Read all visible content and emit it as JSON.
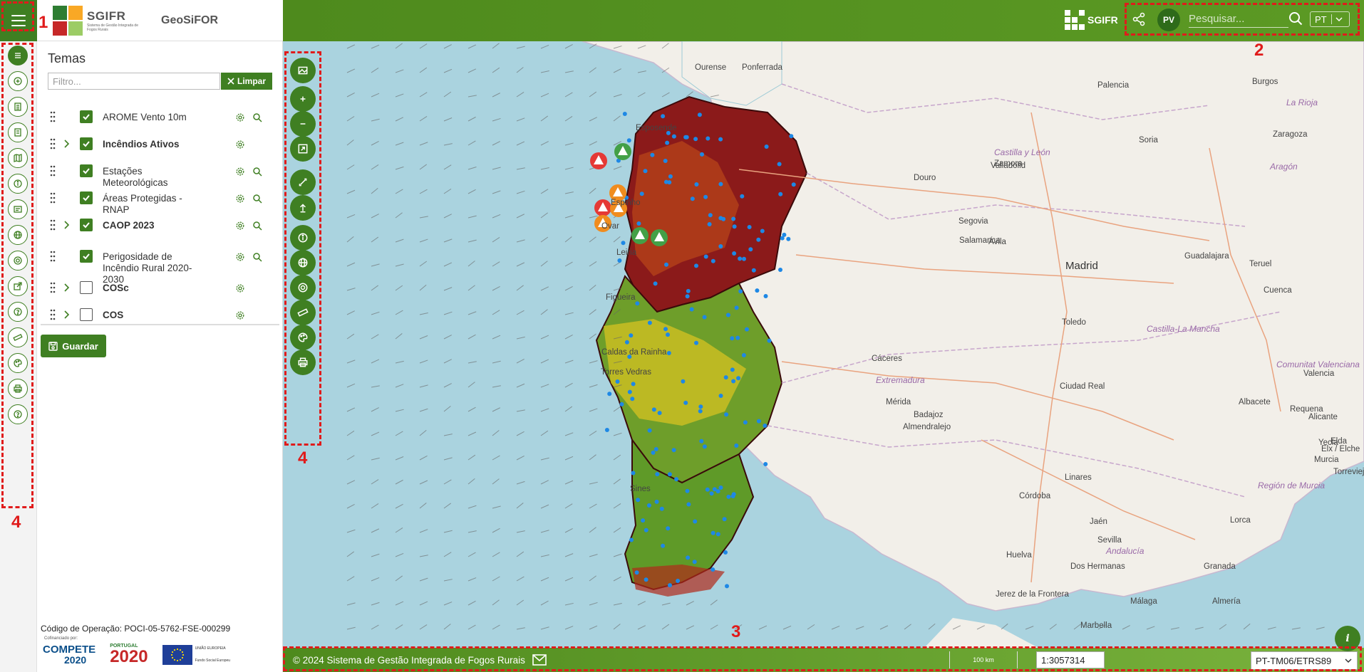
{
  "header": {
    "brand": "SGIFR",
    "brand_tagline": "Sistema de Gestão Integrada de Fogos Rurais",
    "app_title": "GeoSiFOR",
    "right_brand": "SGIFR",
    "avatar_initials": "PV",
    "search_placeholder": "Pesquisar...",
    "language": "PT"
  },
  "sidebar": {
    "icons": [
      "layers-icon",
      "add-layer-icon",
      "legend-icon",
      "document-icon",
      "map-icon",
      "info-icon",
      "image-icon",
      "globe-icon",
      "target-icon",
      "export-icon",
      "help-icon",
      "measure-icon",
      "palette-icon",
      "print-icon",
      "question-icon"
    ]
  },
  "layers_panel": {
    "title": "Temas",
    "filter_placeholder": "Filtro...",
    "clear_label": "Limpar",
    "save_label": "Guardar",
    "layers": [
      {
        "label": "AROME Vento 10m",
        "checked": true,
        "bold": false,
        "expandable": false,
        "has_zoom": true
      },
      {
        "label": "Incêndios Ativos",
        "checked": true,
        "bold": true,
        "expandable": true,
        "has_zoom": false
      },
      {
        "label": "Estações Meteorológicas",
        "checked": true,
        "bold": false,
        "expandable": false,
        "has_zoom": true
      },
      {
        "label": "Áreas Protegidas - RNAP",
        "checked": true,
        "bold": false,
        "expandable": false,
        "has_zoom": true
      },
      {
        "label": "CAOP 2023",
        "checked": true,
        "bold": true,
        "expandable": true,
        "has_zoom": true
      },
      {
        "label": "Perigosidade de Incêndio Rural 2020-2030",
        "checked": true,
        "bold": false,
        "expandable": false,
        "has_zoom": true
      },
      {
        "label": "COSc",
        "checked": false,
        "bold": true,
        "expandable": true,
        "has_zoom": false
      },
      {
        "label": "COS",
        "checked": false,
        "bold": true,
        "expandable": true,
        "has_zoom": false
      }
    ],
    "operation_code": "Código de Operação: POCI-05-5762-FSE-000299",
    "cofinanced_by": "Cofinanciado por:",
    "funders": {
      "compete": "COMPETE",
      "compete_year": "2020",
      "portugal_small": "PORTUGAL",
      "portugal_year": "2020",
      "eu_name": "UNIÃO EUROPEIA",
      "eu_fund": "Fundo Social Europeu"
    }
  },
  "map": {
    "place_labels": [
      {
        "name": "Ourense"
      },
      {
        "name": "Ponferrada"
      },
      {
        "name": "Palencia"
      },
      {
        "name": "Burgos"
      },
      {
        "name": "La Rioja"
      },
      {
        "name": "Castilla y León"
      },
      {
        "name": "Valladolid"
      },
      {
        "name": "Soria"
      },
      {
        "name": "Zaragoza"
      },
      {
        "name": "Aragón"
      },
      {
        "name": "Zamora"
      },
      {
        "name": "Douro"
      },
      {
        "name": "Esposende"
      },
      {
        "name": "Segovia"
      },
      {
        "name": "Espinho"
      },
      {
        "name": "Salamanca"
      },
      {
        "name": "Ávila"
      },
      {
        "name": "Madrid"
      },
      {
        "name": "Guadalajara"
      },
      {
        "name": "Teruel"
      },
      {
        "name": "Cuenca"
      },
      {
        "name": "Toledo"
      },
      {
        "name": "Castilla-La Mancha"
      },
      {
        "name": "Cáceres"
      },
      {
        "name": "Extremadura"
      },
      {
        "name": "Ciudad Real"
      },
      {
        "name": "Comunitat Valenciana"
      },
      {
        "name": "Badajoz"
      },
      {
        "name": "Mérida"
      },
      {
        "name": "Valencia"
      },
      {
        "name": "Albacete"
      },
      {
        "name": "Alicante"
      },
      {
        "name": "Elx / Elche"
      },
      {
        "name": "Murcia"
      },
      {
        "name": "Torrevieja"
      },
      {
        "name": "Región de Murcia"
      },
      {
        "name": "Linares"
      },
      {
        "name": "Jaén"
      },
      {
        "name": "Córdoba"
      },
      {
        "name": "Lorca"
      },
      {
        "name": "Sevilla"
      },
      {
        "name": "Andalucía"
      },
      {
        "name": "Granada"
      },
      {
        "name": "Huelva"
      },
      {
        "name": "Dos Hermanas"
      },
      {
        "name": "Almería"
      },
      {
        "name": "Jerez de la Frontera"
      },
      {
        "name": "Málaga"
      },
      {
        "name": "Marbella"
      },
      {
        "name": "Ovar"
      },
      {
        "name": "Figueira"
      },
      {
        "name": "Caldas da Rainha"
      },
      {
        "name": "Torres Vedras"
      },
      {
        "name": "Yecla"
      },
      {
        "name": "Requena"
      },
      {
        "name": "Elda"
      },
      {
        "name": "Sines"
      },
      {
        "name": "Leiria"
      },
      {
        "name": "Almendralejo"
      }
    ]
  },
  "map_tools": {
    "icons": [
      "basemap-icon",
      "zoom-in-icon",
      "zoom-out-icon",
      "zoom-extent-icon",
      "fullscreen-icon",
      "upload-icon",
      "info-icon",
      "globe-icon",
      "target-icon",
      "measure-icon",
      "palette-icon",
      "print-icon"
    ]
  },
  "footer": {
    "copyright": "© 2024 Sistema de Gestão Integrada de Fogos Rurais",
    "scale_bar_label": "100 km",
    "scale_value": "1:3057314",
    "projection": "PT-TM06/ETRS89",
    "info_label": "i"
  },
  "annotations": [
    "1",
    "2",
    "3",
    "4",
    "4"
  ],
  "colors": {
    "brand_green": "#3f7f22",
    "header_green": "#4e8a1d",
    "sea": "#aad3df",
    "annotation_red": "#e01b1b"
  }
}
